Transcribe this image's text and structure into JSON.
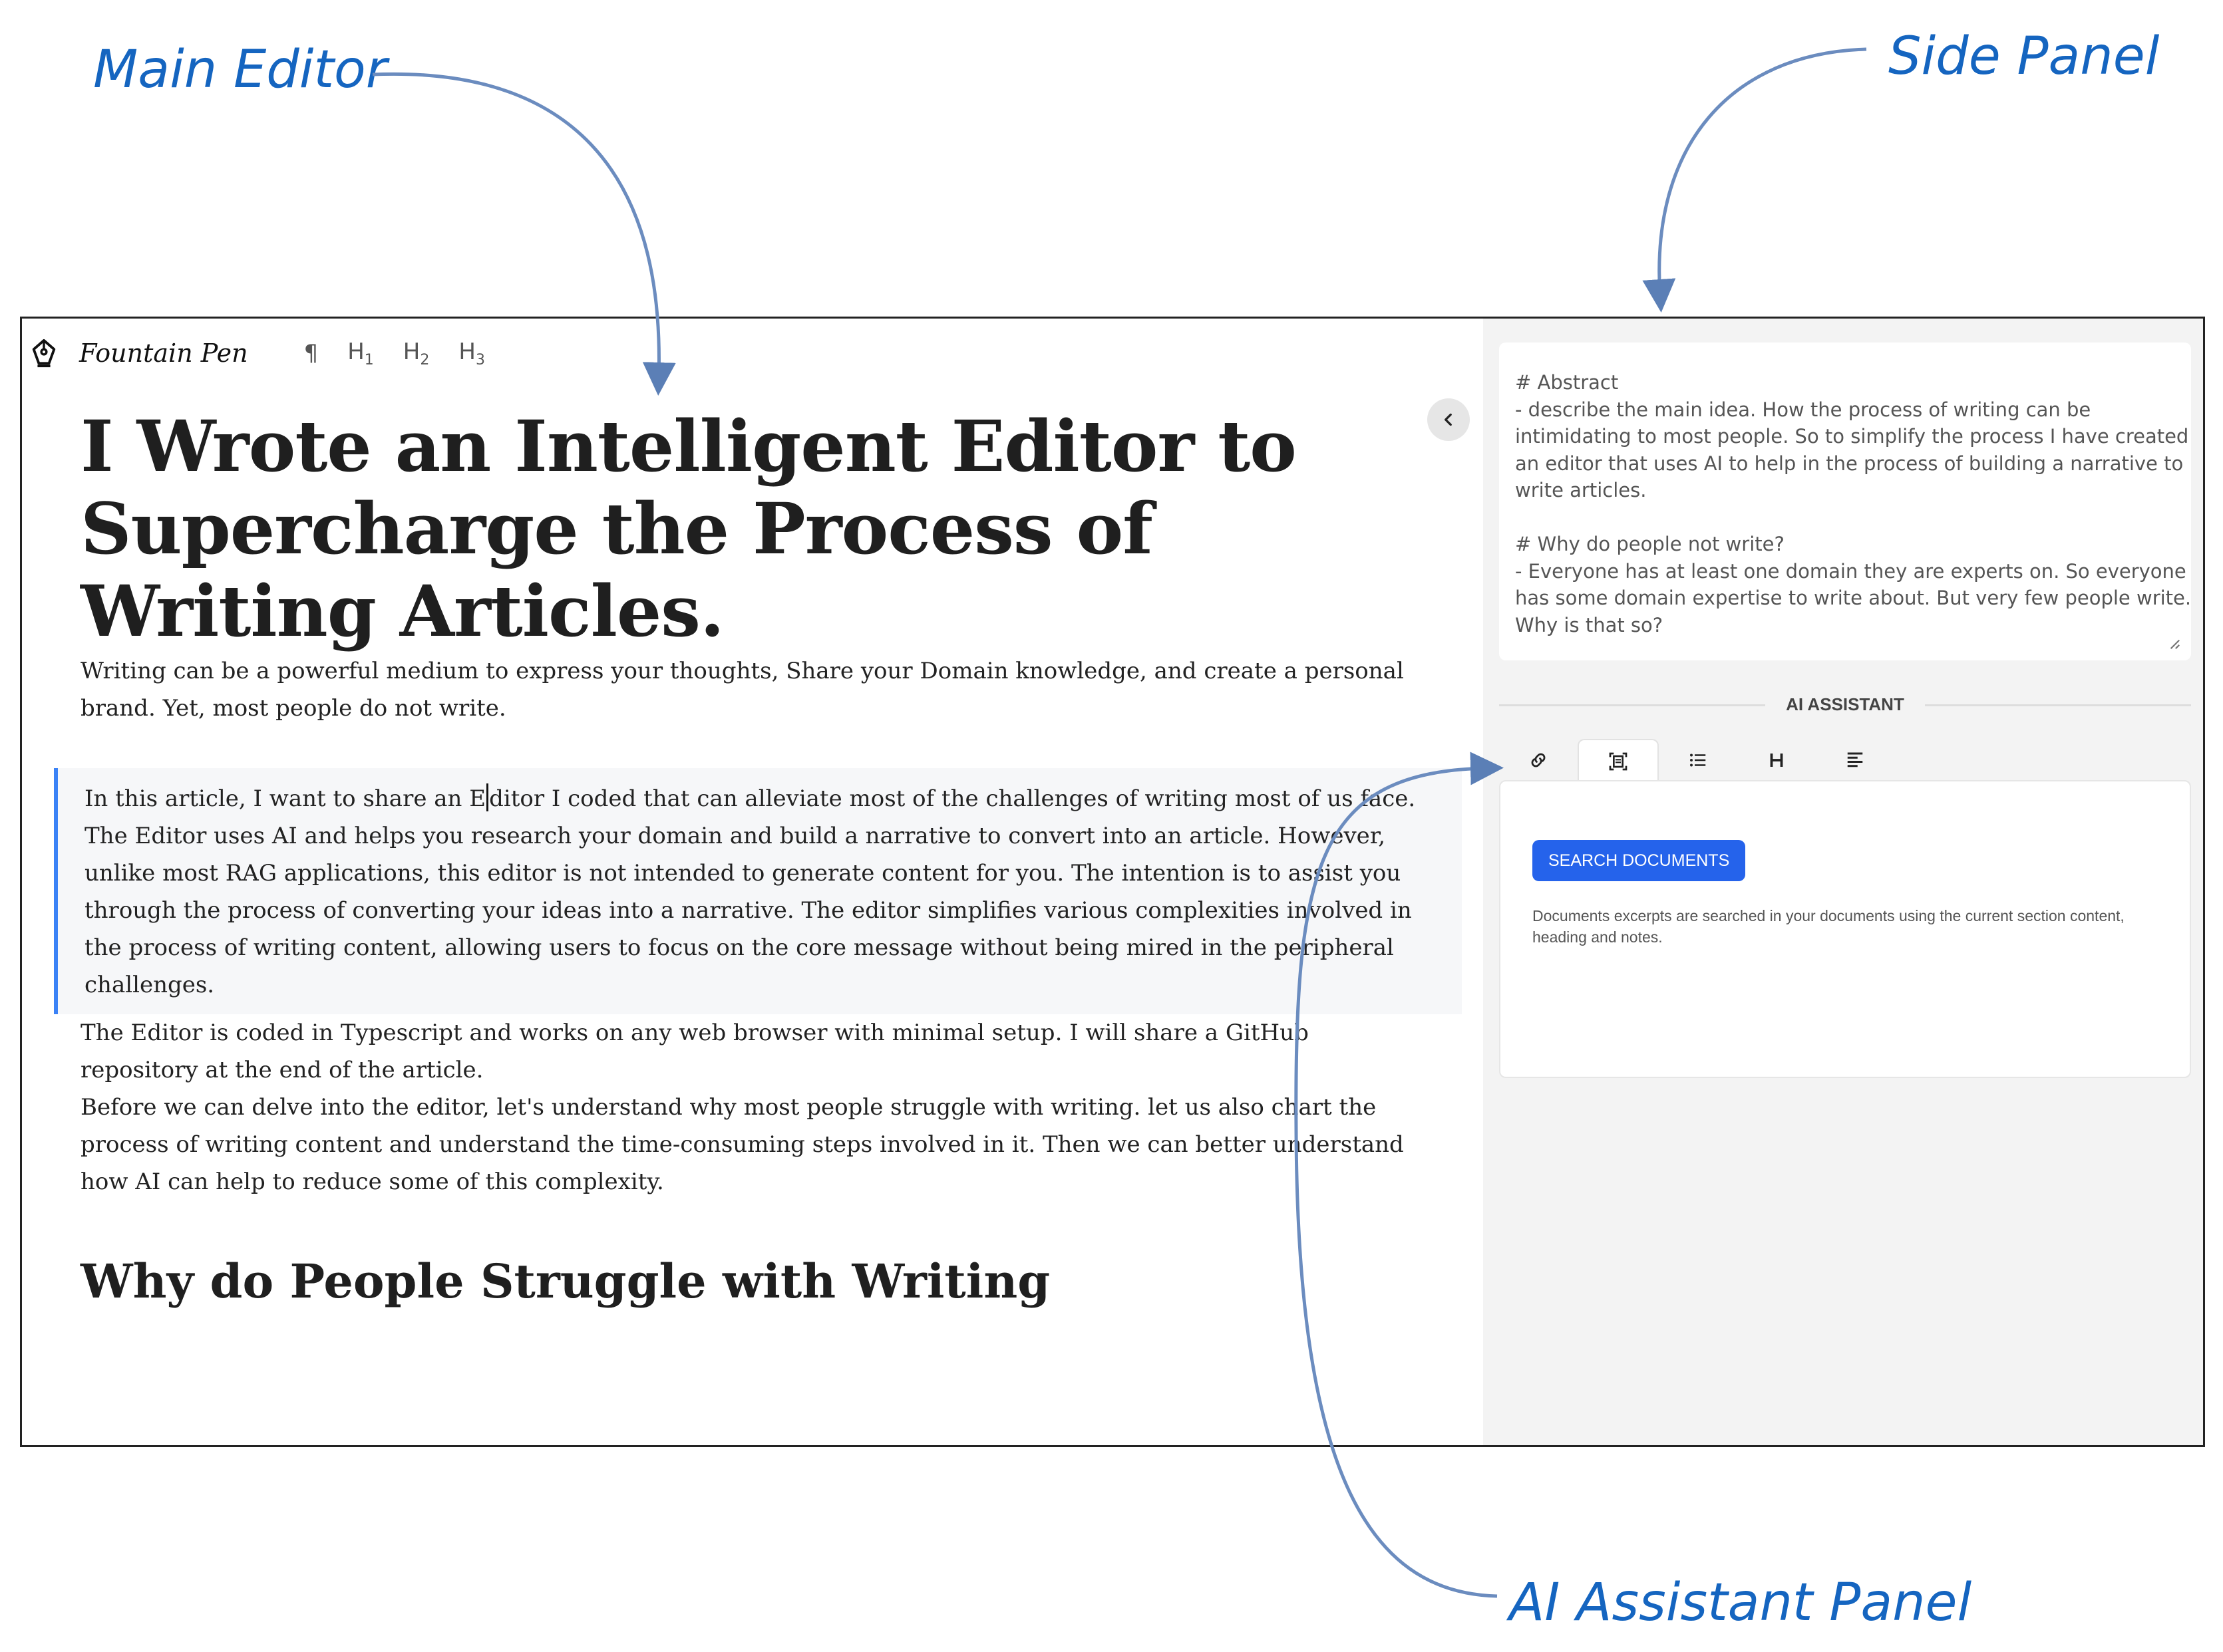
{
  "annotations": {
    "main_editor": "Main Editor",
    "side_panel": "Side Panel",
    "ai_assistant_panel": "AI Assistant Panel"
  },
  "colors": {
    "annotation": "#1565c0",
    "accent_blue": "#2563eb",
    "highlight_border": "#3b82f6"
  },
  "toolbar": {
    "brand": "Fountain Pen",
    "logo_icon": "fountain-pen-icon",
    "paragraph": "¶",
    "h1": "H",
    "h1_sub": "1",
    "h2": "H",
    "h2_sub": "2",
    "h3": "H",
    "h3_sub": "3"
  },
  "editor": {
    "title": "I Wrote an Intelligent Editor to Supercharge the Process of Writing Articles.",
    "para1": "Writing can be a powerful medium to express your thoughts, Share your Domain knowledge, and create a personal brand. Yet, most people do not write.",
    "para2_before_caret": "In this article, I want to share an E",
    "para2_after_caret": "ditor I coded that can alleviate most of the challenges of writing most of us face. The Editor uses AI and helps you research your domain and build a narrative to convert into an article. However, unlike most RAG applications, this editor is not intended to generate content for you. The intention is to assist you through the process of converting your ideas into a narrative. The editor simplifies various complexities involved in the process of writing content, allowing users to focus on the core message without being mired in the peripheral challenges.",
    "para3": "The Editor is coded in Typescript and works on any web browser with minimal setup. I will share a GitHub repository at the end of the article.",
    "para4": "Before we can delve into the editor, let's understand why most people struggle with writing. let us also chart the process of writing content and understand the time-consuming steps involved in it. Then we can better understand how AI can help to reduce some of this complexity.",
    "heading2": "Why do People Struggle with Writing"
  },
  "side_panel": {
    "notes_lines": [
      "# Abstract",
      "- describe the main idea. How the process of writing can be",
      "intimidating to most people. So to simplify the process I have created",
      "an editor that uses AI to help in the process of building a narrative to",
      "write articles.",
      "",
      "# Why do people not write?",
      "- Everyone has at least one domain they are experts on. So everyone",
      "has some domain expertise to write about. But very few people write.",
      "Why is that so?"
    ],
    "ai_label": "AI ASSISTANT",
    "tabs": [
      "link-icon",
      "document-scan-icon",
      "list-icon",
      "heading-icon",
      "align-left-icon"
    ],
    "search_button": "SEARCH DOCUMENTS",
    "help_text": "Documents excerpts are searched in your documents using the current section content, heading and notes."
  }
}
